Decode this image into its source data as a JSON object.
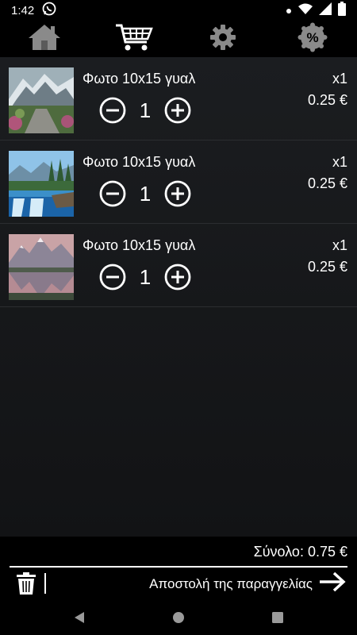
{
  "status_bar": {
    "time": "1:42"
  },
  "toolbar": {
    "tabs": [
      {
        "icon": "home-icon"
      },
      {
        "icon": "cart-icon",
        "active": true
      },
      {
        "icon": "gear-icon"
      },
      {
        "icon": "percent-badge-icon",
        "label": "%"
      }
    ]
  },
  "cart": {
    "items": [
      {
        "title": "Φωτο 10x15 γυαλ",
        "quantity": "1",
        "count": "x1",
        "price": "0.25 €",
        "image": "mountain-stone-path"
      },
      {
        "title": "Φωτο 10x15 γυαλ",
        "quantity": "1",
        "count": "x1",
        "price": "0.25 €",
        "image": "waterfall-forest"
      },
      {
        "title": "Φωτο 10x15 γυαλ",
        "quantity": "1",
        "count": "x1",
        "price": "0.25 €",
        "image": "mountain-lake-reflection"
      }
    ]
  },
  "footer": {
    "total": "Σύνολο: 0.75 €",
    "send_label": "Αποστολή της παραγγελίας"
  },
  "colors": {
    "background": "#000000",
    "list_background": "#1b1d20",
    "accent": "#ffffff"
  }
}
